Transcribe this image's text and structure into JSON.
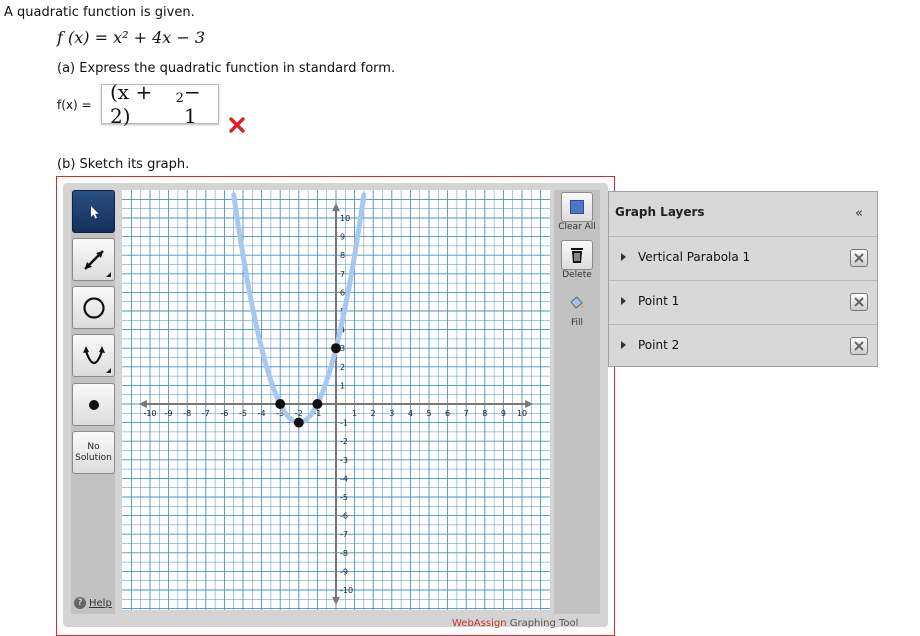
{
  "question": {
    "intro": "A quadratic function is given.",
    "function_text": "f (x) = x² + 4x − 3",
    "part_a": "(a) Express the quadratic function in standard form.",
    "answer_label": "f(x) =",
    "answer_main": "(x + 2)",
    "answer_exp": "2",
    "answer_tail": " − 1",
    "answer_status": "incorrect",
    "part_b": "(b) Sketch its graph."
  },
  "tools": {
    "no_solution_line1": "No",
    "no_solution_line2": "Solution",
    "help": "Help",
    "clear_all": "Clear All",
    "delete": "Delete",
    "fill": "Fill",
    "brand_a": "WebAssign",
    "brand_b": " Graphing Tool"
  },
  "graph": {
    "x_range": [
      -10,
      10
    ],
    "y_range": [
      -10,
      10
    ],
    "x_ticks": [
      "-10",
      "-9",
      "-8",
      "-7",
      "-6",
      "-5",
      "-4",
      "-3",
      "-2",
      "-1",
      "1",
      "2",
      "3",
      "4",
      "5",
      "6",
      "7",
      "8",
      "9",
      "10"
    ],
    "y_ticks": [
      "10",
      "9",
      "8",
      "7",
      "6",
      "5",
      "4",
      "3",
      "2",
      "1",
      "-1",
      "-2",
      "-3",
      "-4",
      "-5",
      "-6",
      "-7",
      "-8",
      "-9",
      "-10"
    ],
    "parabola": {
      "h": -2,
      "k": -1,
      "a": 1
    },
    "points": [
      [
        -3,
        0
      ],
      [
        -1,
        0
      ],
      [
        0,
        3
      ],
      [
        -2,
        -1
      ]
    ],
    "grid_color": "#4a90c0",
    "curve_color": "#a8c8f0"
  },
  "layers": {
    "title": "Graph Layers",
    "collapse": "«",
    "items": [
      "Vertical Parabola 1",
      "Point 1",
      "Point 2"
    ]
  },
  "colors": {
    "error": "#e02020",
    "frame": "#d82c2c"
  }
}
